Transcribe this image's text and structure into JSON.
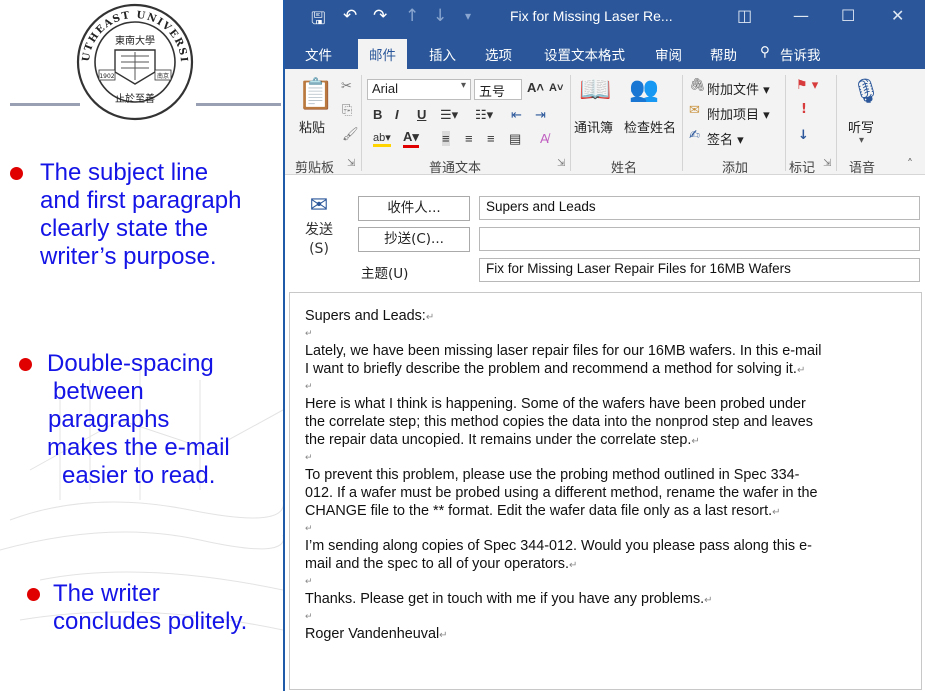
{
  "slide": {
    "logo": {
      "ring_text_top": "SOUTHEAST UNIVERSITY",
      "center_text": "東南大學",
      "year": "1902",
      "city": "南京",
      "motto": "止於至善"
    },
    "bullets": [
      {
        "lines": [
          "The subject line",
          "and first paragraph",
          "clearly state the",
          "writer’s purpose."
        ]
      },
      {
        "lines": [
          "Double-spacing",
          "between",
          "paragraphs",
          "makes the e-mail",
          "easier to read."
        ]
      },
      {
        "lines": [
          "The writer",
          "concludes politely."
        ]
      }
    ],
    "colors": {
      "text": "#1414e6",
      "dot": "#e00000"
    }
  },
  "window": {
    "title": "Fix for Missing Laser Re...",
    "accent": "#2b579a",
    "tabs": [
      "文件",
      "邮件",
      "插入",
      "选项",
      "设置文本格式",
      "审阅",
      "帮助"
    ],
    "active_tab": "邮件",
    "tell_me": "告诉我",
    "ribbon": {
      "paste_label": "粘贴",
      "clipboard_group": "剪贴板",
      "font_name": "Arial",
      "font_size": "五号",
      "basic_text_group": "普通文本",
      "address_book": "通讯簿",
      "check_names": "检查姓名",
      "names_group": "姓名",
      "attach_file": "附加文件",
      "attach_item": "附加项目",
      "signature": "签名",
      "include_group": "添加",
      "tags_group": "标记",
      "dictate": "听写",
      "voice_group": "语音"
    }
  },
  "header": {
    "send_label": "发送",
    "send_key": "(S)",
    "to_button": "收件人...",
    "cc_button": "抄送(C)...",
    "subject_label": "主题(U)",
    "to_value": "Supers and Leads",
    "cc_value": "",
    "subject_value": "Fix for Missing Laser Repair Files for 16MB Wafers"
  },
  "body": {
    "paragraphs": [
      [
        "Supers and Leads:"
      ],
      [
        "Lately, we have been missing laser repair files for our 16MB wafers. In this e-mail",
        "I want to briefly describe the problem and recommend a method for solving it."
      ],
      [
        "Here is what I think is happening. Some of the wafers have been probed under",
        "the correlate step; this method copies the data into the nonprod step and leaves",
        "the repair data uncopied. It remains under the correlate step."
      ],
      [
        "To prevent this problem, please use the probing method outlined in Spec 334-",
        "012. If a wafer must be probed using a different method, rename the wafer in the",
        "CHANGE file to the ** format. Edit the wafer data file only as a last resort."
      ],
      [
        "I’m sending along copies of Spec 344-012. Would you please pass along this e-",
        "mail and the spec to all of your operators."
      ],
      [
        "Thanks. Please get in touch with me if you have any problems."
      ],
      [
        "Roger Vandenheuval"
      ]
    ],
    "para_mark": "↵"
  }
}
